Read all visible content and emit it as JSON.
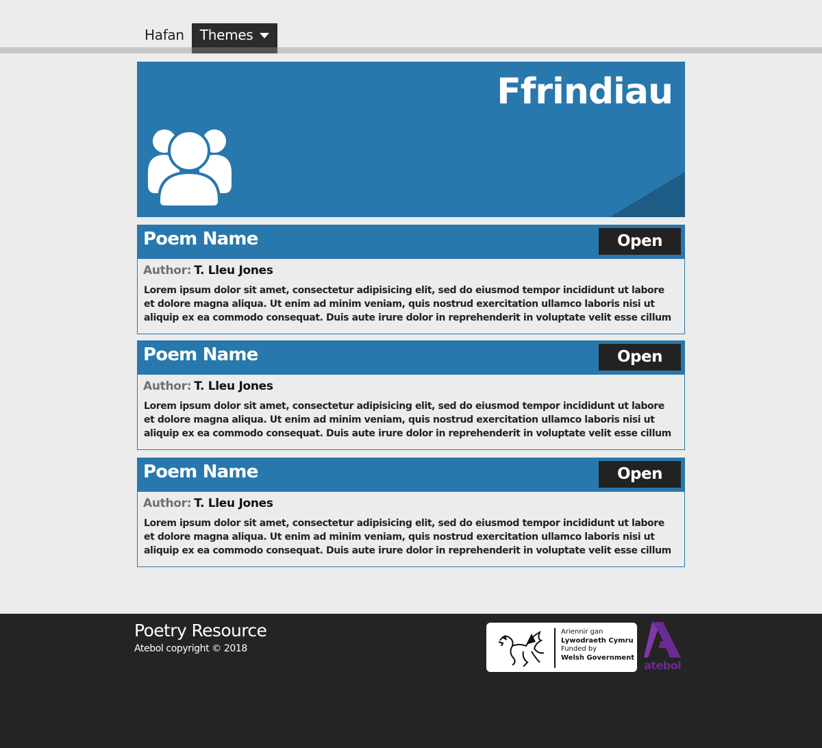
{
  "nav": {
    "home_label": "Hafan",
    "themes_label": "Themes"
  },
  "hero": {
    "title": "Ffrindiau",
    "icon": "group-users-icon",
    "color": "#2878ae"
  },
  "cards": [
    {
      "title": "Poem Name",
      "open_label": "Open",
      "author_label": "Author:",
      "author": "T. Lleu Jones",
      "excerpt": "Lorem ipsum dolor sit amet, consectetur adipisicing elit, sed do eiusmod tempor incididunt ut labore et dolore magna aliqua. Ut enim ad minim veniam, quis nostrud exercitation ullamco laboris nisi ut aliquip ex ea commodo consequat. Duis aute irure dolor in reprehenderit in voluptate velit esse cillum dolore eu"
    },
    {
      "title": "Poem Name",
      "open_label": "Open",
      "author_label": "Author:",
      "author": "T. Lleu Jones",
      "excerpt": "Lorem ipsum dolor sit amet, consectetur adipisicing elit, sed do eiusmod tempor incididunt ut labore et dolore magna aliqua. Ut enim ad minim veniam, quis nostrud exercitation ullamco laboris nisi ut aliquip ex ea commodo consequat. Duis aute irure dolor in reprehenderit in voluptate velit esse cillum dolore eu"
    },
    {
      "title": "Poem Name",
      "open_label": "Open",
      "author_label": "Author:",
      "author": "T. Lleu Jones",
      "excerpt": "Lorem ipsum dolor sit amet, consectetur adipisicing elit, sed do eiusmod tempor incididunt ut labore et dolore magna aliqua. Ut enim ad minim veniam, quis nostrud exercitation ullamco laboris nisi ut aliquip ex ea commodo consequat. Duis aute irure dolor in reprehenderit in voluptate velit esse cillum dolore eu"
    }
  ],
  "footer": {
    "title": "Poetry Resource",
    "copyright": "Atebol copyright © 2018",
    "gov_line1": "Ariennir gan",
    "gov_line2": "Lywodraeth Cymru",
    "gov_line3": "Funded by",
    "gov_line4": "Welsh Government",
    "atebol_logo_text": "atebol",
    "atebol_color": "#6a2a93"
  }
}
